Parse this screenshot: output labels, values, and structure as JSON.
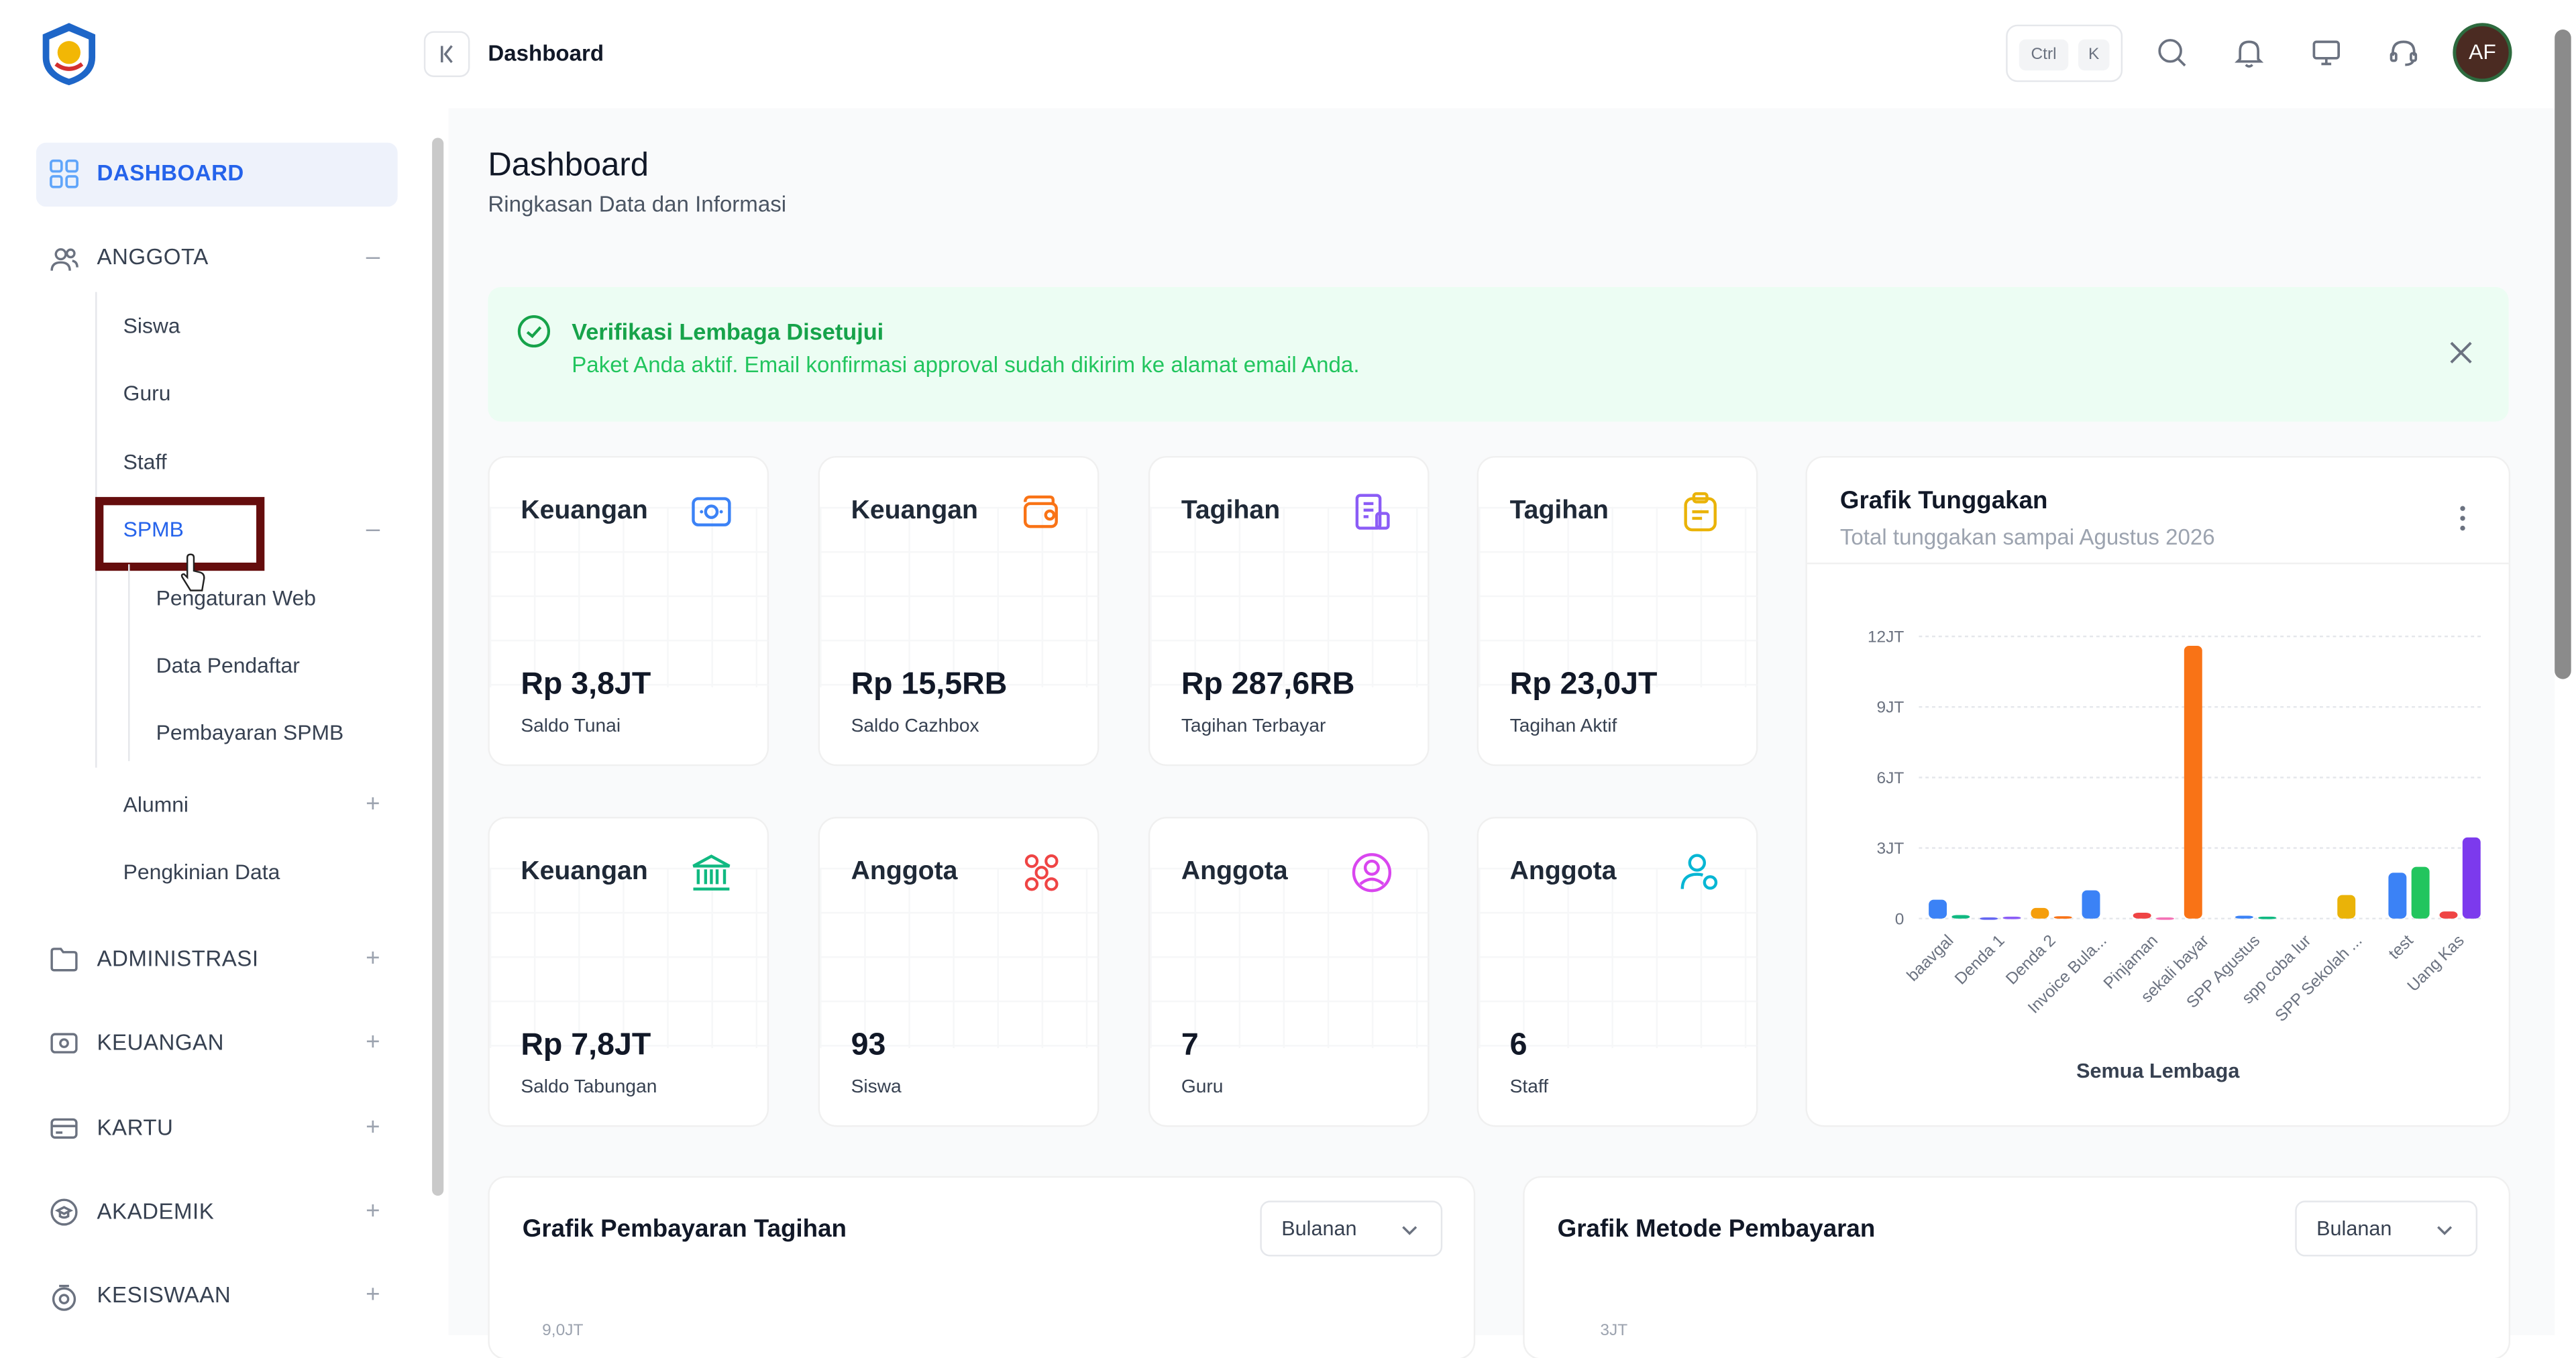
{
  "colors": {
    "accent": "#2563eb",
    "success": "#16a34a",
    "highlight_box": "#650d0d",
    "avatar_bg": "#4b2b22"
  },
  "topbar": {
    "breadcrumb": "Dashboard",
    "shortcut": [
      "Ctrl",
      "K"
    ],
    "avatar": "AF",
    "icons": [
      "search-icon",
      "bell-icon",
      "monitor-icon",
      "headset-icon"
    ]
  },
  "sidebar": {
    "dashboard": "DASHBOARD",
    "anggota": "ANGGOTA",
    "anggota_items": [
      "Siswa",
      "Guru",
      "Staff"
    ],
    "spmb": "SPMB",
    "spmb_items": [
      "Pengaturan Web",
      "Data Pendaftar",
      "Pembayaran SPMB"
    ],
    "alumni": "Alumni",
    "pengkinian": "Pengkinian Data",
    "groups": [
      "ADMINISTRASI",
      "KEUANGAN",
      "KARTU",
      "AKADEMIK",
      "KESISWAAN"
    ]
  },
  "page": {
    "title": "Dashboard",
    "subtitle": "Ringkasan Data dan Informasi"
  },
  "alert": {
    "title": "Verifikasi Lembaga Disetujui",
    "message": "Paket Anda aktif. Email konfirmasi approval sudah dikirim ke alamat email Anda."
  },
  "cards": [
    {
      "title": "Keuangan",
      "value": "Rp 3,8JT",
      "label": "Saldo Tunai",
      "icon": "cash-icon",
      "color": "#3b82f6"
    },
    {
      "title": "Keuangan",
      "value": "Rp 15,5RB",
      "label": "Saldo Cazhbox",
      "icon": "wallet-icon",
      "color": "#f97316"
    },
    {
      "title": "Tagihan",
      "value": "Rp 287,6RB",
      "label": "Tagihan Terbayar",
      "icon": "receipt-icon",
      "color": "#8b5cf6"
    },
    {
      "title": "Tagihan",
      "value": "Rp 23,0JT",
      "label": "Tagihan Aktif",
      "icon": "clipboard-icon",
      "color": "#eab308"
    },
    {
      "title": "Keuangan",
      "value": "Rp 7,8JT",
      "label": "Saldo Tabungan",
      "icon": "bank-icon",
      "color": "#10b981"
    },
    {
      "title": "Anggota",
      "value": "93",
      "label": "Siswa",
      "icon": "group-icon",
      "color": "#ef4444"
    },
    {
      "title": "Anggota",
      "value": "7",
      "label": "Guru",
      "icon": "user-circle-icon",
      "color": "#d946ef"
    },
    {
      "title": "Anggota",
      "value": "6",
      "label": "Staff",
      "icon": "user-settings-icon",
      "color": "#06b6d4"
    }
  ],
  "chart_card": {
    "title": "Grafik Tunggakan",
    "subtitle": "Total tunggakan sampai Agustus 2026",
    "menu_icon": "more-vertical-icon"
  },
  "chart_data": {
    "type": "bar",
    "xlabel": "Semua Lembaga",
    "ylabel": "",
    "y_ticks": [
      "0",
      "3JT",
      "6JT",
      "9JT",
      "12JT"
    ],
    "ylim": [
      0,
      12000000
    ],
    "grid": true,
    "categories": [
      "baavgal",
      "Denda 1",
      "Denda 2",
      "Invoice Bula...",
      "Pinjaman",
      "sekali bayar",
      "SPP Agustus",
      "spp coba lur",
      "SPP Sekolah ...",
      "test",
      "Uang Kas"
    ],
    "bars": [
      {
        "category": "baavgal",
        "color": "#3b82f6",
        "value": 800000
      },
      {
        "category": "baavgal",
        "color": "#10b981",
        "value": 150000
      },
      {
        "category": "Denda 1",
        "color": "#6366f1",
        "value": 50000
      },
      {
        "category": "Denda 1",
        "color": "#8b5cf6",
        "value": 80000
      },
      {
        "category": "Denda 2",
        "color": "#f59e0b",
        "value": 450000
      },
      {
        "category": "Denda 2",
        "color": "#f97316",
        "value": 100000
      },
      {
        "category": "Invoice Bula...",
        "color": "#3b82f6",
        "value": 1200000
      },
      {
        "category": "Pinjaman",
        "color": "#ef4444",
        "value": 250000
      },
      {
        "category": "Pinjaman",
        "color": "#f472b6",
        "value": 50000
      },
      {
        "category": "sekali bayar",
        "color": "#f97316",
        "value": 11600000
      },
      {
        "category": "SPP Agustus",
        "color": "#3b82f6",
        "value": 120000
      },
      {
        "category": "SPP Agustus",
        "color": "#10b981",
        "value": 80000
      },
      {
        "category": "SPP Sekolah ...",
        "color": "#eab308",
        "value": 1000000
      },
      {
        "category": "test",
        "color": "#3b82f6",
        "value": 1950000
      },
      {
        "category": "test",
        "color": "#22c55e",
        "value": 2200000
      },
      {
        "category": "Uang Kas",
        "color": "#ef4444",
        "value": 300000
      },
      {
        "category": "Uang Kas",
        "color": "#7c3aed",
        "value": 3450000
      }
    ]
  },
  "bottom": {
    "left_title": "Grafik Pembayaran Tagihan",
    "left_select": "Bulanan",
    "left_tick": "9,0JT",
    "right_title": "Grafik Metode Pembayaran",
    "right_select": "Bulanan",
    "right_tick": "3JT"
  }
}
